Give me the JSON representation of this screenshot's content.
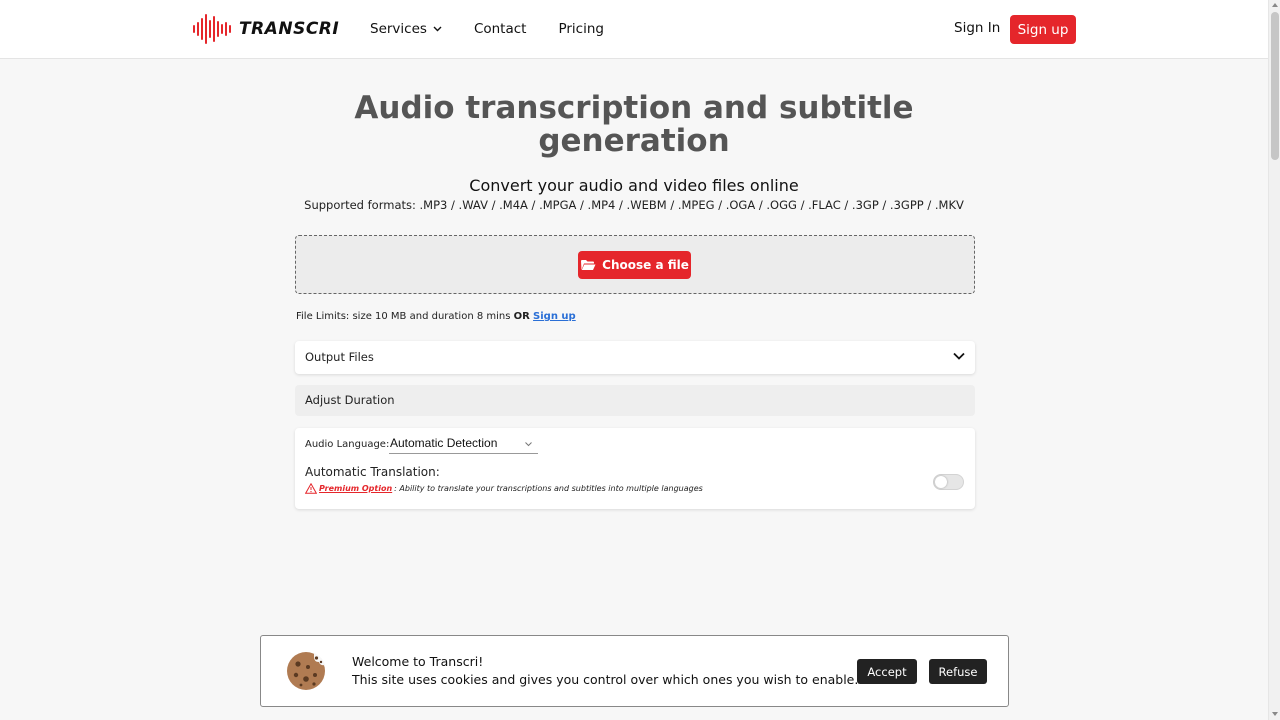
{
  "header": {
    "logo_text": "TRANSCRI",
    "nav": [
      {
        "label": "Services"
      },
      {
        "label": "Contact"
      },
      {
        "label": "Pricing"
      }
    ],
    "sign_in": "Sign In",
    "sign_up": "Sign up"
  },
  "hero": {
    "title_line1": "Audio transcription and subtitle",
    "title_line2": "generation",
    "subtitle": "Convert your audio and video files online",
    "formats": "Supported formats: .MP3 / .WAV / .M4A / .MPGA / .MP4 / .WEBM / .MPEG / .OGA / .OGG / .FLAC / .3GP / .3GPP / .MKV"
  },
  "upload": {
    "button_label": "Choose a file",
    "limits_text": "File Limits: size 10 MB and duration 8 mins",
    "limits_or": "OR",
    "limits_link": "Sign up"
  },
  "options": {
    "output_files": "Output Files",
    "adjust_duration": "Adjust Duration",
    "audio_language_label": "Audio Language:",
    "audio_language_value": "Automatic Detection",
    "translation_label": "Automatic Translation:",
    "premium_link": "Premium Option",
    "premium_text": ": Ability to translate your transcriptions and subtitles into multiple languages",
    "translation_enabled": false
  },
  "cookie": {
    "title": "Welcome to Transcri!",
    "text": "This site uses cookies and gives you control over which ones you wish to enable.",
    "accept": "Accept",
    "refuse": "Refuse"
  },
  "colors": {
    "brand_red": "#e5262b",
    "link_blue": "#2a6fd6",
    "dark_button": "#222222"
  }
}
